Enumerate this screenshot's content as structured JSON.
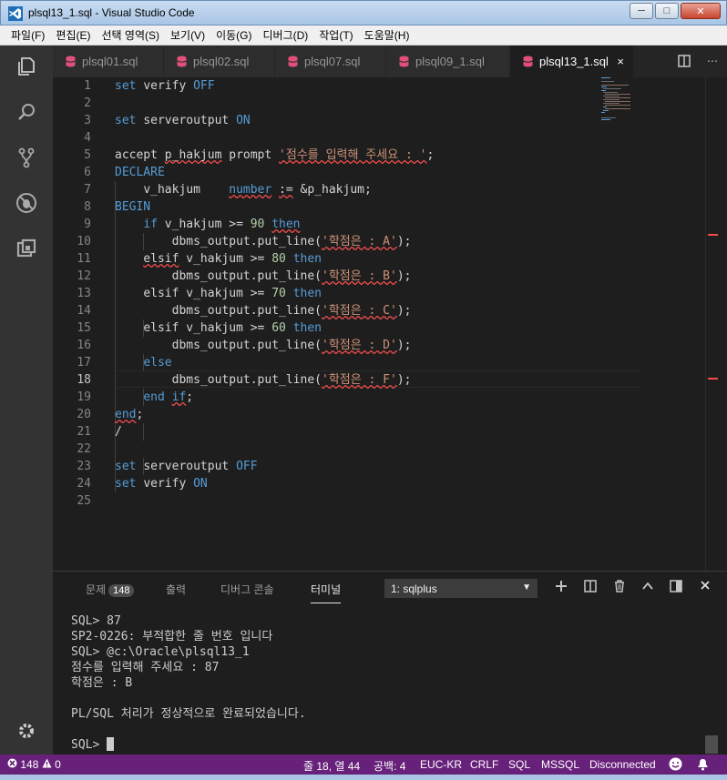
{
  "window": {
    "title": "plsql13_1.sql - Visual Studio Code",
    "min_label": "─",
    "max_label": "□",
    "close_label": "✕"
  },
  "menu": [
    "파일(F)",
    "편집(E)",
    "선택 영역(S)",
    "보기(V)",
    "이동(G)",
    "디버그(D)",
    "작업(T)",
    "도움말(H)"
  ],
  "tabs": [
    {
      "label": "plsql01.sql",
      "active": false
    },
    {
      "label": "plsql02.sql",
      "active": false
    },
    {
      "label": "plsql07.sql",
      "active": false
    },
    {
      "label": "plsql09_1.sql",
      "active": false
    },
    {
      "label": "plsql13_1.sql",
      "active": true
    }
  ],
  "tab_close": "×",
  "tab_actions": {
    "split": "split-editor-icon",
    "more": "⋯"
  },
  "editor": {
    "current_line": 18,
    "line_numbers": [
      "1",
      "2",
      "3",
      "4",
      "5",
      "6",
      "7",
      "8",
      "9",
      "10",
      "11",
      "12",
      "13",
      "14",
      "15",
      "16",
      "17",
      "18",
      "19",
      "20",
      "21",
      "22",
      "23",
      "24",
      "25"
    ],
    "lines": [
      {
        "code": "set verify OFF"
      },
      {
        "code": ""
      },
      {
        "code": "set serveroutput ON"
      },
      {
        "code": ""
      },
      {
        "code": "accept p_hakjum prompt '점수를 입력해 주세요 : ';"
      },
      {
        "code": "DECLARE"
      },
      {
        "code": "    v_hakjum    number := &p_hakjum;"
      },
      {
        "code": "BEGIN"
      },
      {
        "code": "    if v_hakjum >= 90 then"
      },
      {
        "code": "        dbms_output.put_line('학점은 : A');"
      },
      {
        "code": "    elsif v_hakjum >= 80 then"
      },
      {
        "code": "        dbms_output.put_line('학점은 : B');"
      },
      {
        "code": "    elsif v_hakjum >= 70 then"
      },
      {
        "code": "        dbms_output.put_line('학점은 : C');"
      },
      {
        "code": "    elsif v_hakjum >= 60 then"
      },
      {
        "code": "        dbms_output.put_line('학점은 : D');"
      },
      {
        "code": "    else"
      },
      {
        "code": "        dbms_output.put_line('학점은 : F');"
      },
      {
        "code": "    end if;"
      },
      {
        "code": "end;"
      },
      {
        "code": "/"
      },
      {
        "code": ""
      },
      {
        "code": "set serveroutput OFF"
      },
      {
        "code": "set verify ON"
      },
      {
        "code": ""
      }
    ]
  },
  "panel": {
    "tabs": [
      {
        "label": "문제",
        "badge": "148"
      },
      {
        "label": "출력"
      },
      {
        "label": "디버그 콘솔"
      },
      {
        "label": "터미널",
        "active": true
      }
    ],
    "terminal_select": "1: sqlplus",
    "terminal_lines": [
      "SQL> 87",
      "SP2-0226: 부적합한 줄 번호 입니다",
      "SQL> @c:\\Oracle\\plsql13_1",
      "점수를 입력해 주세요 : 87",
      "학점은 : B",
      "",
      "PL/SQL 처리가 정상적으로 완료되었습니다.",
      "",
      "SQL> "
    ]
  },
  "status": {
    "errors": "148",
    "warnings": "0",
    "position": "줄 18, 열 44",
    "spaces": "공백: 4",
    "encoding": "EUC-KR",
    "eol": "CRLF",
    "language": "SQL",
    "dialect": "MSSQL",
    "connection": "Disconnected"
  },
  "colors": {
    "statusbar": "#68217a",
    "keyword": "#569cd6",
    "string": "#ce9178",
    "number": "#b5cea8",
    "db_icon": "#e0507a"
  }
}
